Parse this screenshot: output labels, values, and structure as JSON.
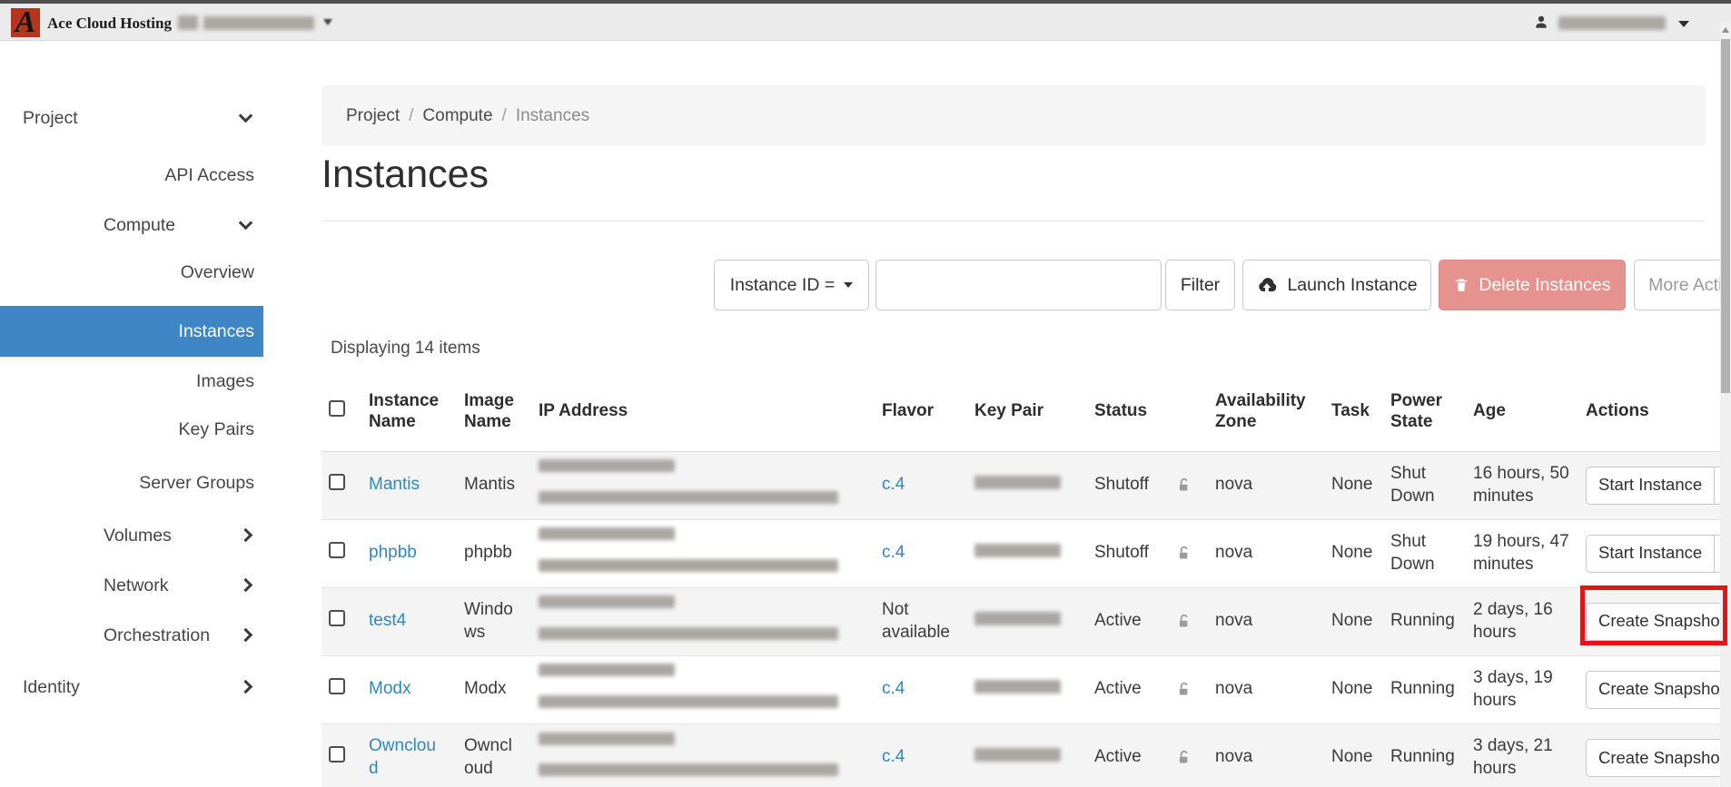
{
  "topbar": {
    "brand": "Ace Cloud Hosting",
    "logo_letter": "A"
  },
  "redacted_fields": [
    "project_switcher_name",
    "user_name",
    "ip_address",
    "key_pair"
  ],
  "sidebar": {
    "items": [
      {
        "label": "Project",
        "level": 1,
        "chevron": "down",
        "active": false
      },
      {
        "label": "API Access",
        "level": 3,
        "chevron": null,
        "active": false
      },
      {
        "label": "Compute",
        "level": 2,
        "chevron": "down",
        "active": false
      },
      {
        "label": "Overview",
        "level": 3,
        "chevron": null,
        "active": false
      },
      {
        "label": "Instances",
        "level": 3,
        "chevron": null,
        "active": true
      },
      {
        "label": "Images",
        "level": 3,
        "chevron": null,
        "active": false
      },
      {
        "label": "Key Pairs",
        "level": 3,
        "chevron": null,
        "active": false
      },
      {
        "label": "Server Groups",
        "level": 3,
        "chevron": null,
        "active": false
      },
      {
        "label": "Volumes",
        "level": 2,
        "chevron": "right",
        "active": false
      },
      {
        "label": "Network",
        "level": 2,
        "chevron": "right",
        "active": false
      },
      {
        "label": "Orchestration",
        "level": 2,
        "chevron": "right",
        "active": false
      },
      {
        "label": "Identity",
        "level": 1,
        "chevron": "right",
        "active": false
      }
    ]
  },
  "breadcrumb": {
    "link1": "Project",
    "link2": "Compute",
    "current": "Instances",
    "separator": "/"
  },
  "page": {
    "title": "Instances",
    "items_count": "Displaying 14 items"
  },
  "filter": {
    "dropdown_label": "Instance ID =",
    "search_value": "",
    "filter_button": "Filter",
    "launch_button": "Launch Instance",
    "delete_button": "Delete Instances",
    "more_button": "More Actions"
  },
  "table": {
    "headers": {
      "instance_name": "Instance Name",
      "image_name": "Image Name",
      "ip_address": "IP Address",
      "flavor": "Flavor",
      "key_pair": "Key Pair",
      "status": "Status",
      "availability_zone": "Availability Zone",
      "task": "Task",
      "power_state": "Power State",
      "age": "Age",
      "actions": "Actions"
    },
    "rows": [
      {
        "instance_name": "Mantis",
        "image_name": "Mantis",
        "ip_redacted": true,
        "flavor": "c.4",
        "flavor_is_link": true,
        "key_pair_redacted": true,
        "status": "Shutoff",
        "availability_zone": "nova",
        "task": "None",
        "power_state": "Shut Down",
        "age": "16 hours, 50 minutes",
        "action": "Start Instance",
        "highlighted": false
      },
      {
        "instance_name": "phpbb",
        "image_name": "phpbb",
        "ip_redacted": true,
        "flavor": "c.4",
        "flavor_is_link": true,
        "key_pair_redacted": true,
        "status": "Shutoff",
        "availability_zone": "nova",
        "task": "None",
        "power_state": "Shut Down",
        "age": "19 hours, 47 minutes",
        "action": "Start Instance",
        "highlighted": false
      },
      {
        "instance_name": "test4",
        "image_name": "Windows",
        "ip_redacted": true,
        "flavor": "Not available",
        "flavor_is_link": false,
        "key_pair_redacted": true,
        "status": "Active",
        "availability_zone": "nova",
        "task": "None",
        "power_state": "Running",
        "age": "2 days, 16 hours",
        "action": "Create Snapshot",
        "highlighted": true
      },
      {
        "instance_name": "Modx",
        "image_name": "Modx",
        "ip_redacted": true,
        "flavor": "c.4",
        "flavor_is_link": true,
        "key_pair_redacted": true,
        "status": "Active",
        "availability_zone": "nova",
        "task": "None",
        "power_state": "Running",
        "age": "3 days, 19 hours",
        "action": "Create Snapshot",
        "highlighted": false
      },
      {
        "instance_name": "Owncloud",
        "image_name": "Owncloud",
        "ip_redacted": true,
        "flavor": "c.4",
        "flavor_is_link": true,
        "key_pair_redacted": true,
        "status": "Active",
        "availability_zone": "nova",
        "task": "None",
        "power_state": "Running",
        "age": "3 days, 21 hours",
        "action": "Create Snapshot",
        "highlighted": false
      }
    ]
  },
  "colors": {
    "sidebar_active_bg": "#3e86c6",
    "link_blue": "#2f87c3",
    "delete_button_bg": "#e6938f",
    "annotation_red": "#e0151b",
    "topbar_bg": "#ebebeb",
    "breadcrumb_bg": "#f5f5f5",
    "stripe_bg": "#f4f4f4"
  }
}
